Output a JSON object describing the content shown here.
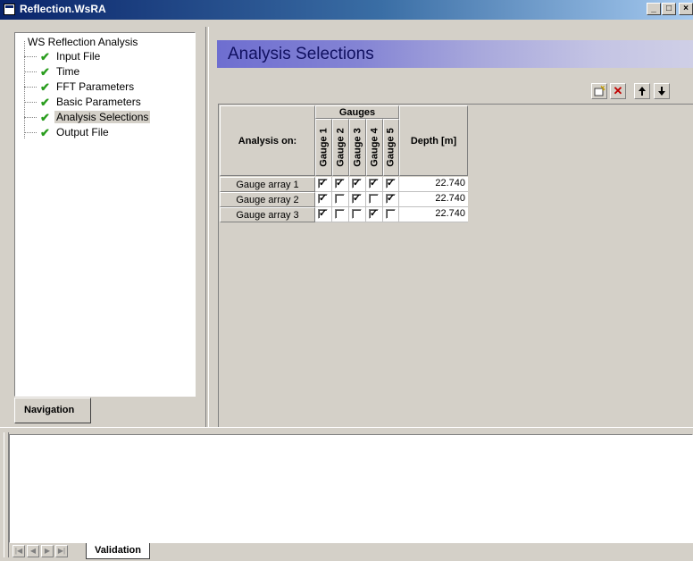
{
  "window": {
    "title": "Reflection.WsRA",
    "controls": [
      "_",
      "□",
      "×"
    ]
  },
  "navigation": {
    "root": "WS Reflection Analysis",
    "items": [
      {
        "label": "Input File",
        "checked": true
      },
      {
        "label": "Time",
        "checked": true
      },
      {
        "label": "FFT Parameters",
        "checked": true
      },
      {
        "label": "Basic Parameters",
        "checked": true
      },
      {
        "label": "Analysis Selections",
        "checked": true,
        "selected": true
      },
      {
        "label": "Output File",
        "checked": true
      }
    ],
    "tab_label": "Navigation"
  },
  "main": {
    "title": "Analysis Selections",
    "toolbar": {
      "new": "new-row-icon",
      "delete": "delete-icon",
      "up": "arrow-up-icon",
      "down": "arrow-down-icon"
    },
    "table": {
      "analysis_header": "Analysis on:",
      "group_header": "Gauges",
      "gauge_headers": [
        "Gauge 1",
        "Gauge 2",
        "Gauge 3",
        "Gauge 4",
        "Gauge 5"
      ],
      "depth_header": "Depth [m]",
      "rows": [
        {
          "label": "Gauge array 1",
          "checks": [
            true,
            true,
            true,
            true,
            true
          ],
          "depth": "22.740"
        },
        {
          "label": "Gauge array 2",
          "checks": [
            true,
            false,
            true,
            false,
            true
          ],
          "depth": "22.740"
        },
        {
          "label": "Gauge array 3",
          "checks": [
            true,
            false,
            false,
            true,
            false
          ],
          "depth": "22.740"
        }
      ]
    }
  },
  "bottom": {
    "tab_label": "Validation"
  }
}
